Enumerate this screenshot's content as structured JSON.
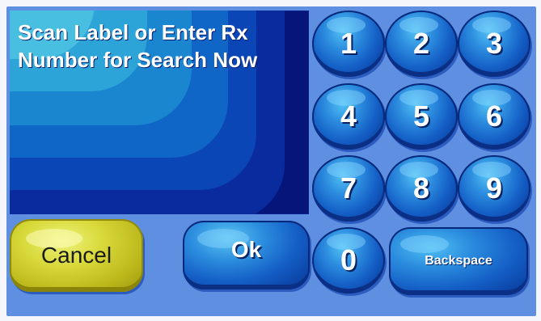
{
  "display": {
    "message": "Scan Label or Enter Rx Number for Search Now"
  },
  "keypad": {
    "keys": [
      "1",
      "2",
      "3",
      "4",
      "5",
      "6",
      "7",
      "8",
      "9",
      "0"
    ],
    "backspace_label": "Backspace"
  },
  "actions": {
    "cancel_label": "Cancel",
    "ok_label": "Ok"
  },
  "colors": {
    "panel_background": "#5f8fe0",
    "display_background": "#06157a",
    "key_blue": "#145fc6",
    "cancel_yellow": "#d8d93a",
    "text_white": "#ffffff"
  }
}
